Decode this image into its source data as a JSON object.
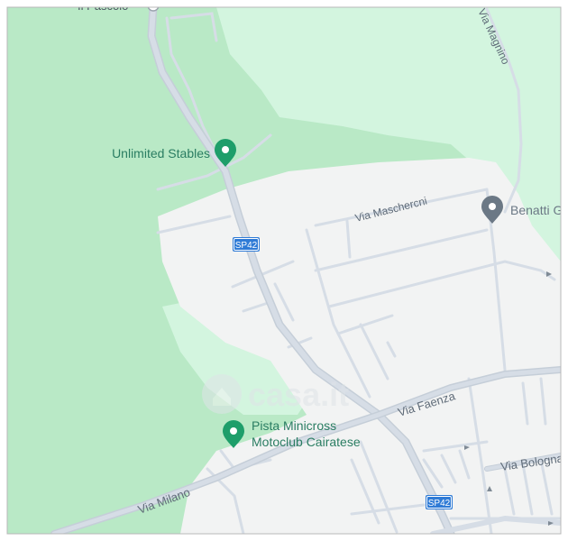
{
  "map": {
    "colors": {
      "green_dark": "#b9e9c6",
      "green_light": "#d3f5df",
      "urban": "#f2f3f3",
      "road": "#d6dde6",
      "road_outline": "#c5ced8",
      "road_label": "#5f6b78",
      "poi_green": "#1e9e6a",
      "poi_label": "#2a7d62",
      "poi_gray": "#6b7885",
      "shield_bg": "#2f7bd6",
      "shield_text": "#ffffff",
      "border": "#b8b8b8"
    },
    "top_label": "Il Pascolo",
    "top_right_label": "Via Magnino",
    "pois": [
      {
        "name": "Unlimited Stables",
        "icon": "map-pin-icon"
      },
      {
        "name": "Benatti G",
        "icon": "map-pin-icon"
      },
      {
        "line1": "Pista Minicross",
        "line2": "Motoclub Cairatese",
        "icon": "map-pin-icon"
      }
    ],
    "roads": {
      "via_maschercni": "Via Maschercni",
      "via_faenza": "Via Faenza",
      "via_milano": "Via Milano",
      "via_bologna": "Via Bologna"
    },
    "shields": [
      "SP42",
      "SP42"
    ],
    "watermark": "casa.it"
  }
}
